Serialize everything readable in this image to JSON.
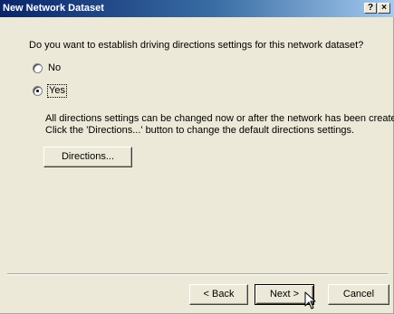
{
  "window": {
    "title": "New Network Dataset",
    "help_glyph": "?",
    "close_glyph": "×"
  },
  "content": {
    "question": "Do you want to establish driving directions settings for this network dataset?",
    "options": [
      {
        "label": "No",
        "selected": false
      },
      {
        "label": "Yes",
        "selected": true
      }
    ],
    "info_line1": "All directions settings can be changed now or after the network has been created.",
    "info_line2": "Click the 'Directions...' button to change the default directions settings.",
    "directions_button": "Directions..."
  },
  "footer": {
    "back_label": "< Back",
    "next_label": "Next >",
    "cancel_label": "Cancel"
  },
  "icons": {
    "cursor": "mouse-pointer-icon"
  }
}
